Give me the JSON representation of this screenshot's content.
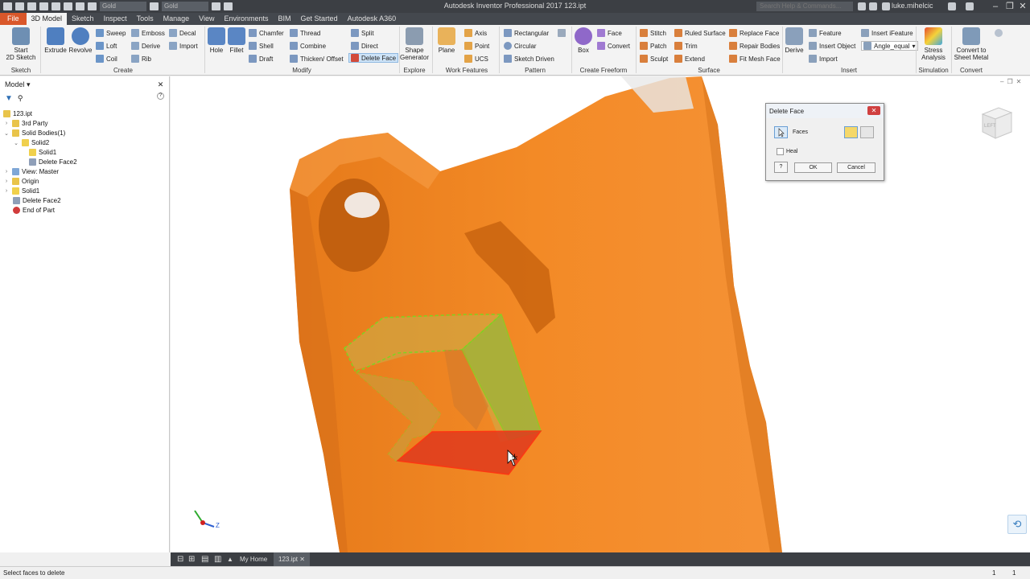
{
  "window": {
    "app_title": "Autodesk Inventor Professional 2017    123.ipt",
    "appearance_dropdown": "Gold",
    "material_dropdown": "Gold",
    "search_placeholder": "Search Help & Commands...",
    "user": "luke.mihelcic"
  },
  "ribbon_tabs": [
    "File",
    "3D Model",
    "Sketch",
    "Inspect",
    "Tools",
    "Manage",
    "View",
    "Environments",
    "BIM",
    "Get Started",
    "Autodesk A360"
  ],
  "ribbon_active_tab": "3D Model",
  "ribbon": {
    "sketch": {
      "start_line1": "Start",
      "start_line2": "2D Sketch",
      "group": "Sketch"
    },
    "create": {
      "extrude": "Extrude",
      "revolve": "Revolve",
      "sweep": "Sweep",
      "loft": "Loft",
      "coil": "Coil",
      "emboss": "Emboss",
      "derive": "Derive",
      "rib": "Rib",
      "decal": "Decal",
      "import": "Import",
      "group": "Create"
    },
    "modify": {
      "hole": "Hole",
      "fillet": "Fillet",
      "chamfer": "Chamfer",
      "shell": "Shell",
      "draft": "Draft",
      "thread": "Thread",
      "combine": "Combine",
      "thicken": "Thicken/ Offset",
      "split": "Split",
      "direct": "Direct",
      "delete_face": "Delete Face",
      "group": "Modify"
    },
    "explore": {
      "shape_line1": "Shape",
      "shape_line2": "Generator",
      "group": "Explore"
    },
    "work": {
      "plane": "Plane",
      "axis": "Axis",
      "point": "Point",
      "ucs": "UCS",
      "group": "Work Features"
    },
    "pattern": {
      "rectangular": "Rectangular",
      "circular": "Circular",
      "sketch_driven": "Sketch Driven",
      "group": "Pattern"
    },
    "freeform": {
      "box": "Box",
      "face": "Face",
      "convert": "Convert",
      "group": "Create Freeform"
    },
    "surface": {
      "stitch": "Stitch",
      "patch": "Patch",
      "sculpt": "Sculpt",
      "ruled": "Ruled Surface",
      "trim": "Trim",
      "extend": "Extend",
      "replace": "Replace Face",
      "repair": "Repair Bodies",
      "fit_mesh": "Fit Mesh Face",
      "group": "Surface"
    },
    "insert": {
      "derive": "Derive",
      "feature": "Feature",
      "insert_object": "Insert Object",
      "import": "Import",
      "ifeature": "Insert iFeature",
      "angle": "Angle_equal",
      "group": "Insert"
    },
    "simulation": {
      "stress_line1": "Stress",
      "stress_line2": "Analysis",
      "group": "Simulation"
    },
    "convert": {
      "sheet_line1": "Convert to",
      "sheet_line2": "Sheet Metal",
      "group": "Convert"
    }
  },
  "browser": {
    "title": "Model",
    "tree": [
      {
        "label": "123.ipt"
      },
      {
        "label": "3rd Party"
      },
      {
        "label": "Solid Bodies(1)"
      },
      {
        "label": "Solid2"
      },
      {
        "label": "Solid1"
      },
      {
        "label": "Delete Face2"
      },
      {
        "label": "View: Master"
      },
      {
        "label": "Origin"
      },
      {
        "label": "Solid1"
      },
      {
        "label": "Delete Face2"
      },
      {
        "label": "End of Part"
      }
    ]
  },
  "dialog": {
    "title": "Delete Face",
    "faces_label": "Faces",
    "heal_label": "Heal",
    "ok": "OK",
    "cancel": "Cancel"
  },
  "viewcube_label": "LEFT",
  "doc_tabs": {
    "home": "My Home",
    "file": "123.ipt"
  },
  "status": {
    "text": "Select faces to delete",
    "count1": "1",
    "count2": "1"
  },
  "colors": {
    "model": "#f08a28",
    "selection_green": "#7ed321",
    "selection_red": "#e03a1e",
    "file_tab": "#d9572a"
  }
}
